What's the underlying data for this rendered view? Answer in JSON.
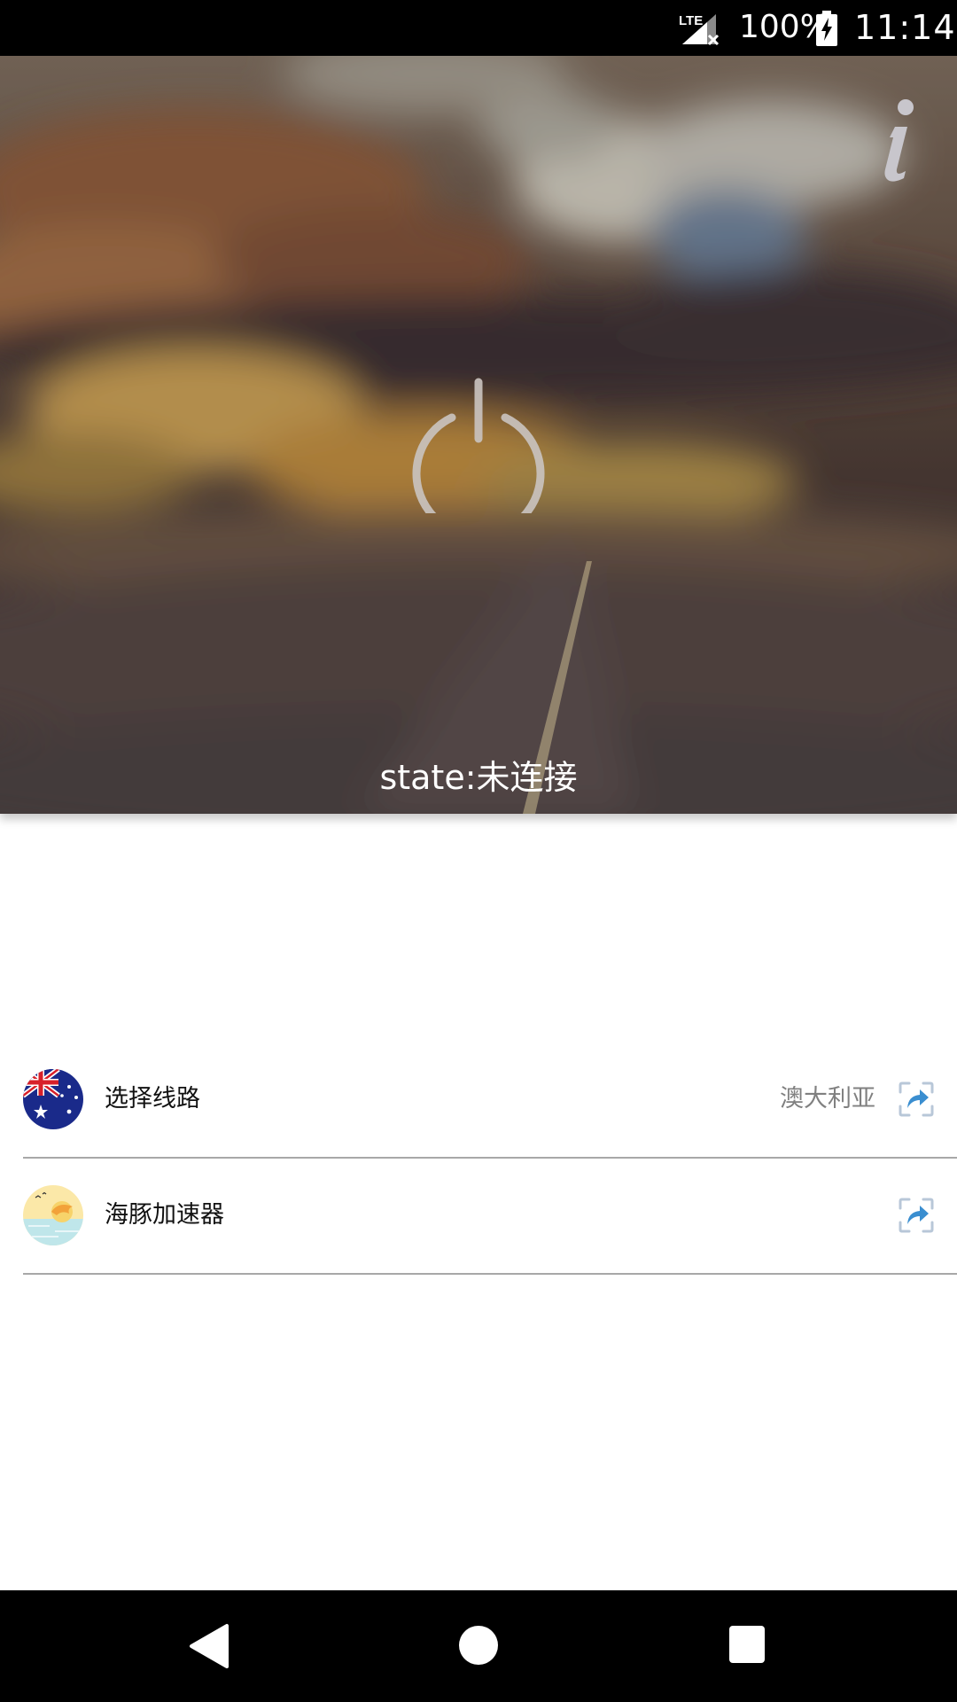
{
  "status_bar": {
    "network": "LTE",
    "battery_percent": "100%",
    "time": "11:14"
  },
  "hero": {
    "state_text": "state:未连接",
    "power_icon": "power-icon",
    "info_icon": "info-icon"
  },
  "list": {
    "rows": [
      {
        "label": "选择线路",
        "value": "澳大利亚",
        "avatar_icon": "australia-flag-icon",
        "action_icon": "share-icon"
      },
      {
        "label": "海豚加速器",
        "value": "",
        "avatar_icon": "dolphin-app-icon",
        "action_icon": "share-icon"
      }
    ]
  },
  "nav_bar": {
    "back_icon": "back-icon",
    "home_icon": "home-icon",
    "recents_icon": "recents-icon"
  },
  "colors": {
    "status_bar": "#000000",
    "nav_bar": "#000000",
    "divider": "#a8a8a8",
    "secondary_text": "#808080",
    "share_accent": "#3a8ed0"
  }
}
